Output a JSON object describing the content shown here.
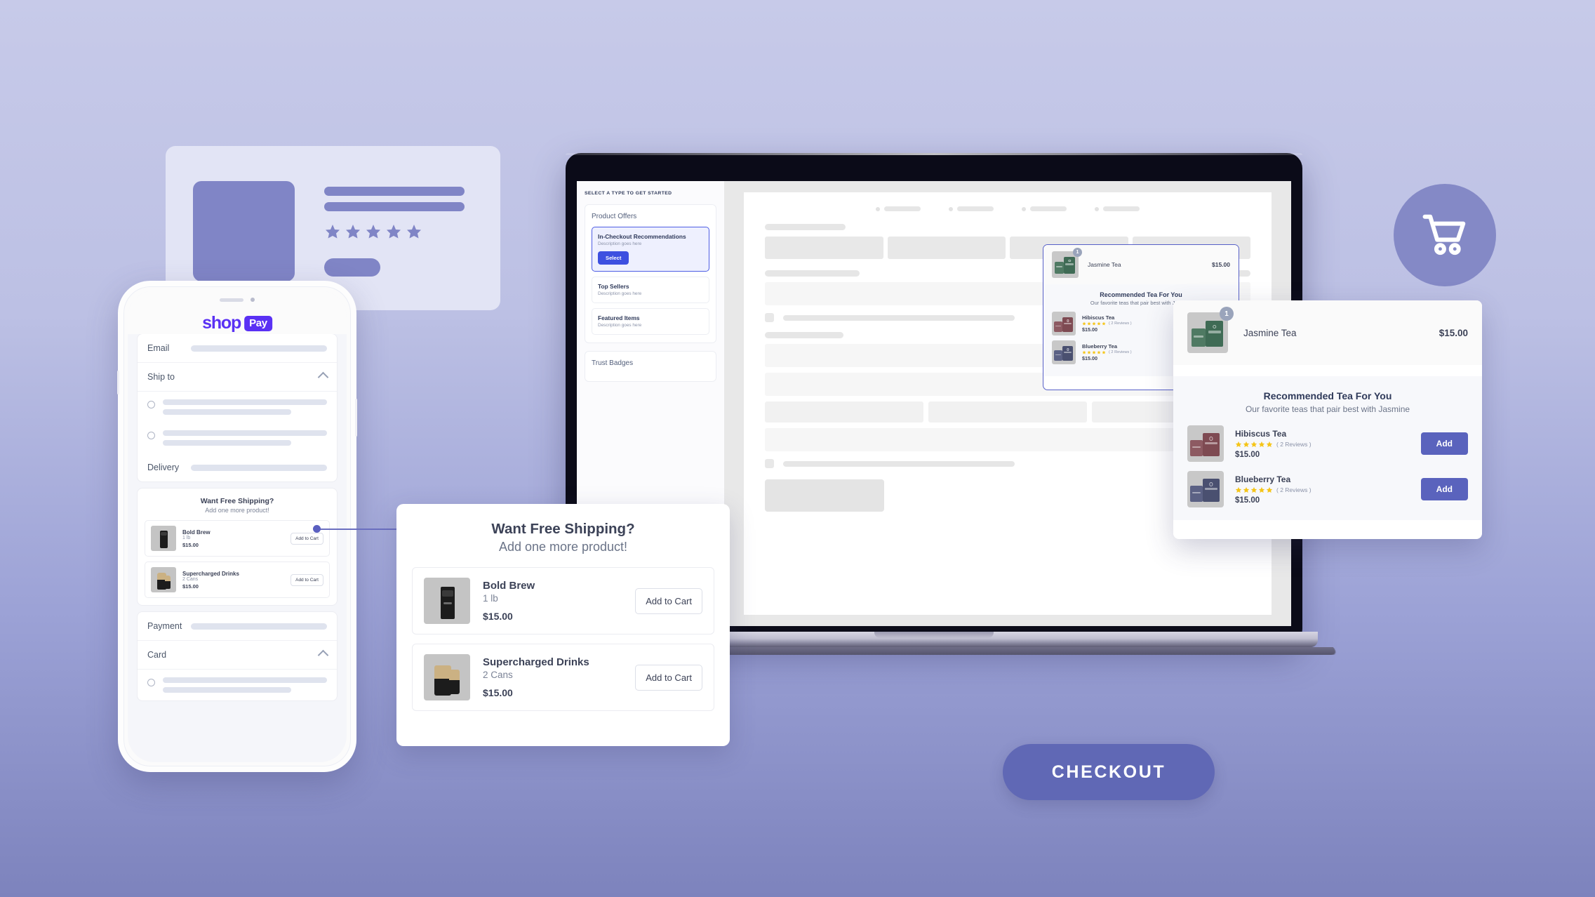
{
  "brand": {
    "logo_shop": "shop",
    "logo_pay": "Pay",
    "accent_purple": "#5a31f4",
    "accent_blue": "#3d50e0",
    "accent_periwinkle": "#6068b5",
    "star_color": "#f5c518"
  },
  "phone": {
    "fields": [
      {
        "label": "Email"
      },
      {
        "label": "Ship to"
      },
      {
        "label": "Delivery"
      },
      {
        "label": "Payment"
      },
      {
        "label": "Card"
      }
    ],
    "offer_mini": {
      "title": "Want Free Shipping?",
      "subtitle": "Add one more product!",
      "items": [
        {
          "name": "Bold Brew",
          "variant": "1 lb",
          "price": "$15.00",
          "button": "Add to Cart",
          "icon": "coffee-bag-icon"
        },
        {
          "name": "Supercharged Drinks",
          "variant": "2 Cans",
          "price": "$15.00",
          "button": "Add to Cart",
          "icon": "drink-can-icon"
        }
      ]
    }
  },
  "freeship_card": {
    "title": "Want Free Shipping?",
    "subtitle": "Add one more product!",
    "items": [
      {
        "name": "Bold Brew",
        "variant": "1 lb",
        "price": "$15.00",
        "button": "Add to Cart",
        "icon": "coffee-bag-icon"
      },
      {
        "name": "Supercharged Drinks",
        "variant": "2 Cans",
        "price": "$15.00",
        "button": "Add to Cart",
        "icon": "drink-can-icon"
      }
    ]
  },
  "laptop": {
    "sidebar": {
      "eyebrow": "SELECT A TYPE TO GET STARTED",
      "group_title": "Product Offers",
      "options": [
        {
          "title": "In-Checkout Recommendations",
          "desc": "Description goes here",
          "button": "Select",
          "selected": true
        },
        {
          "title": "Top Sellers",
          "desc": "Description goes here",
          "selected": false
        },
        {
          "title": "Featured Items",
          "desc": "Description goes here",
          "selected": false
        }
      ],
      "second_group_title": "Trust Badges"
    }
  },
  "tea_popup": {
    "cart_line": {
      "name": "Jasmine Tea",
      "price": "$15.00",
      "qty": "1"
    },
    "title": "Recommended Tea For You",
    "subtitle": "Our favorite teas that pair best with Jasmine",
    "items": [
      {
        "name": "Hibiscus Tea",
        "stars": 5,
        "reviews": "( 2 Reviews )",
        "price": "$15.00",
        "button": "Add",
        "color": "#7e4a52"
      },
      {
        "name": "Blueberry Tea",
        "stars": 5,
        "reviews": "( 2 Reviews )",
        "price": "$15.00",
        "button": "Add",
        "color": "#4a5070"
      }
    ]
  },
  "cart_icon": "shopping-cart-icon",
  "checkout": {
    "label": "CHECKOUT"
  }
}
